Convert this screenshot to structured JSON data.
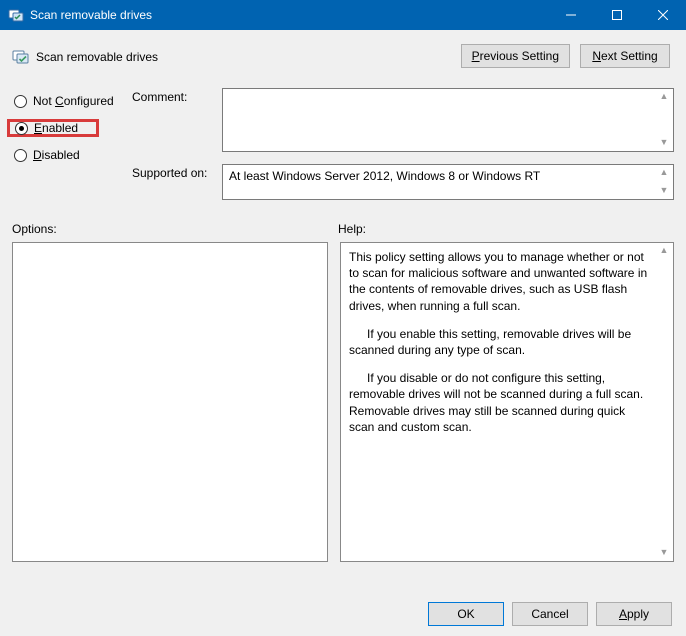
{
  "window": {
    "title": "Scan removable drives"
  },
  "header": {
    "title": "Scan removable drives"
  },
  "nav": {
    "previous_prefix": "P",
    "previous_rest": "revious Setting",
    "next_prefix": "N",
    "next_rest": "ext Setting"
  },
  "state": {
    "not_configured": {
      "prefix": "C",
      "before": "Not ",
      "after": "onfigured",
      "selected": false
    },
    "enabled": {
      "prefix": "E",
      "after": "nabled",
      "selected": true
    },
    "disabled": {
      "prefix": "D",
      "after": "isabled",
      "selected": false
    }
  },
  "fields": {
    "comment_label": "Comment:",
    "comment_value": "",
    "supported_label": "Supported on:",
    "supported_value": "At least Windows Server 2012, Windows 8 or Windows RT"
  },
  "sections": {
    "options_label": "Options:",
    "help_label": "Help:"
  },
  "options_content": "",
  "help_paragraphs": [
    "This policy setting allows you to manage whether or not to scan for malicious software and unwanted software in the contents of removable drives, such as USB flash drives, when running a full scan.",
    "If you enable this setting, removable drives will be scanned during any type of scan.",
    "If you disable or do not configure this setting, removable drives will not be scanned during a full scan. Removable drives may still be scanned during quick scan and custom scan."
  ],
  "footer": {
    "ok": "OK",
    "cancel": "Cancel",
    "apply_prefix": "A",
    "apply_rest": "pply"
  }
}
